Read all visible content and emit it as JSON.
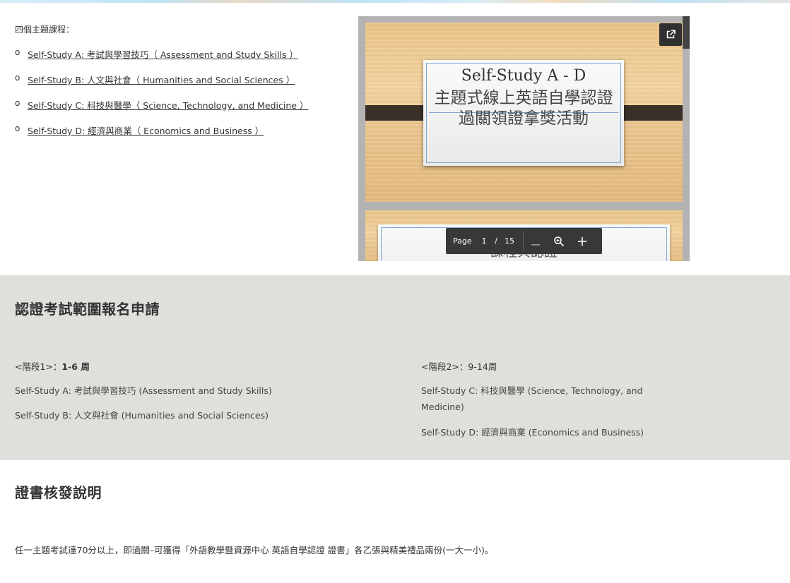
{
  "intro": {
    "label": "四個主題課程：",
    "bullet": "o",
    "courses": [
      "Self-Study A: 考試與學習技巧（ Assessment and Study Skills ）",
      "Self-Study B: 人文與社會（ Humanities and Social Sciences ）",
      "Self-Study C: 科技與醫學（ Science, Technology, and Medicine ）",
      "Self-Study D: 經濟與商業（ Economics and Business ）"
    ]
  },
  "pdf_viewer": {
    "slide1_title": "Self-Study A - D",
    "slide1_subtitle": "主題式線上英語自學認證過關領證拿獎活動",
    "slide2_title": "課程與認證",
    "toolbar": {
      "page_label": "Page",
      "current_page": "1",
      "separator": "/",
      "total_pages": "15"
    },
    "icons": {
      "popout": "open-in-new-icon",
      "zoom_out": "minus-icon",
      "zoom": "magnifier-icon",
      "zoom_in": "plus-icon"
    }
  },
  "exam_section": {
    "heading": "認證考試範圍報名申請",
    "stage1_label": "<階段1>：",
    "stage1_weeks": "1-6 周",
    "stage1_items": [
      "Self-Study A: 考試與學習技巧 (Assessment and Study Skills)",
      "Self-Study B: 人文與社會 (Humanities and Social Sciences)"
    ],
    "stage2_label": "<階段2>：9-14周",
    "stage2_items": [
      "Self-Study C: 科技與醫學 (Science, Technology, and Medicine)",
      "Self-Study D: 經濟與商業 (Economics and Business)"
    ]
  },
  "cert_section": {
    "heading": "證書核發說明",
    "text": "任一主題考試達70分以上，即過關–可獲得「外語教學暨資源中心 英語自學認證 證書」各乙張與精美禮品兩份(一大一小)。"
  },
  "colors": {
    "section_grey": "#e0dfdc",
    "toolbar": "#383838",
    "slide_border": "#7fa5cf"
  }
}
